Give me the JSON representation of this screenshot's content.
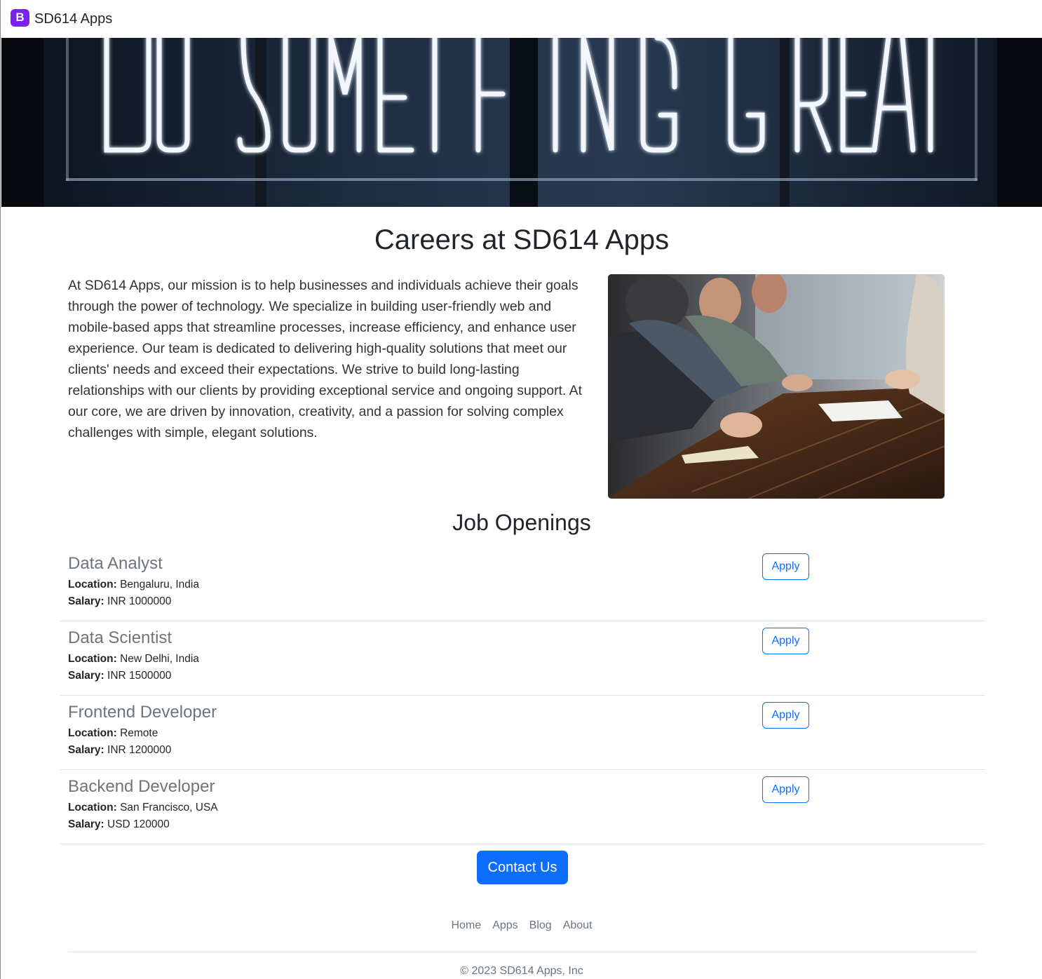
{
  "navbar": {
    "brand_logo": "B",
    "brand_name": "SD614 Apps"
  },
  "hero": {
    "sign_text": "DO SOMETHING GREAT"
  },
  "page_title": "Careers at SD614 Apps",
  "intro_text": "At SD614 Apps, our mission is to help businesses and individuals achieve their goals through the power of technology. We specialize in building user-friendly web and mobile-based apps that streamline processes, increase efficiency, and enhance user experience. Our team is dedicated to delivering high-quality solutions that meet our clients' needs and exceed their expectations. We strive to build long-lasting relationships with our clients by providing exceptional service and ongoing support. At our core, we are driven by innovation, creativity, and a passion for solving complex challenges with simple, elegant solutions.",
  "jobs_section": {
    "title": "Job Openings",
    "location_label": "Location:",
    "salary_label": "Salary:",
    "apply_label": "Apply",
    "jobs": [
      {
        "title": "Data Analyst",
        "location": "Bengaluru, India",
        "salary": "INR 1000000"
      },
      {
        "title": "Data Scientist",
        "location": "New Delhi, India",
        "salary": "INR 1500000"
      },
      {
        "title": "Frontend Developer",
        "location": "Remote",
        "salary": "INR 1200000"
      },
      {
        "title": "Backend Developer",
        "location": "San Francisco, USA",
        "salary": "USD 120000"
      }
    ]
  },
  "contact_button": "Contact Us",
  "footer": {
    "links": [
      "Home",
      "Apps",
      "Blog",
      "About"
    ],
    "copyright": "© 2023 SD614 Apps, Inc"
  },
  "colors": {
    "primary": "#0d6efd",
    "brand": "#7b22f0",
    "muted": "#6c757d"
  }
}
